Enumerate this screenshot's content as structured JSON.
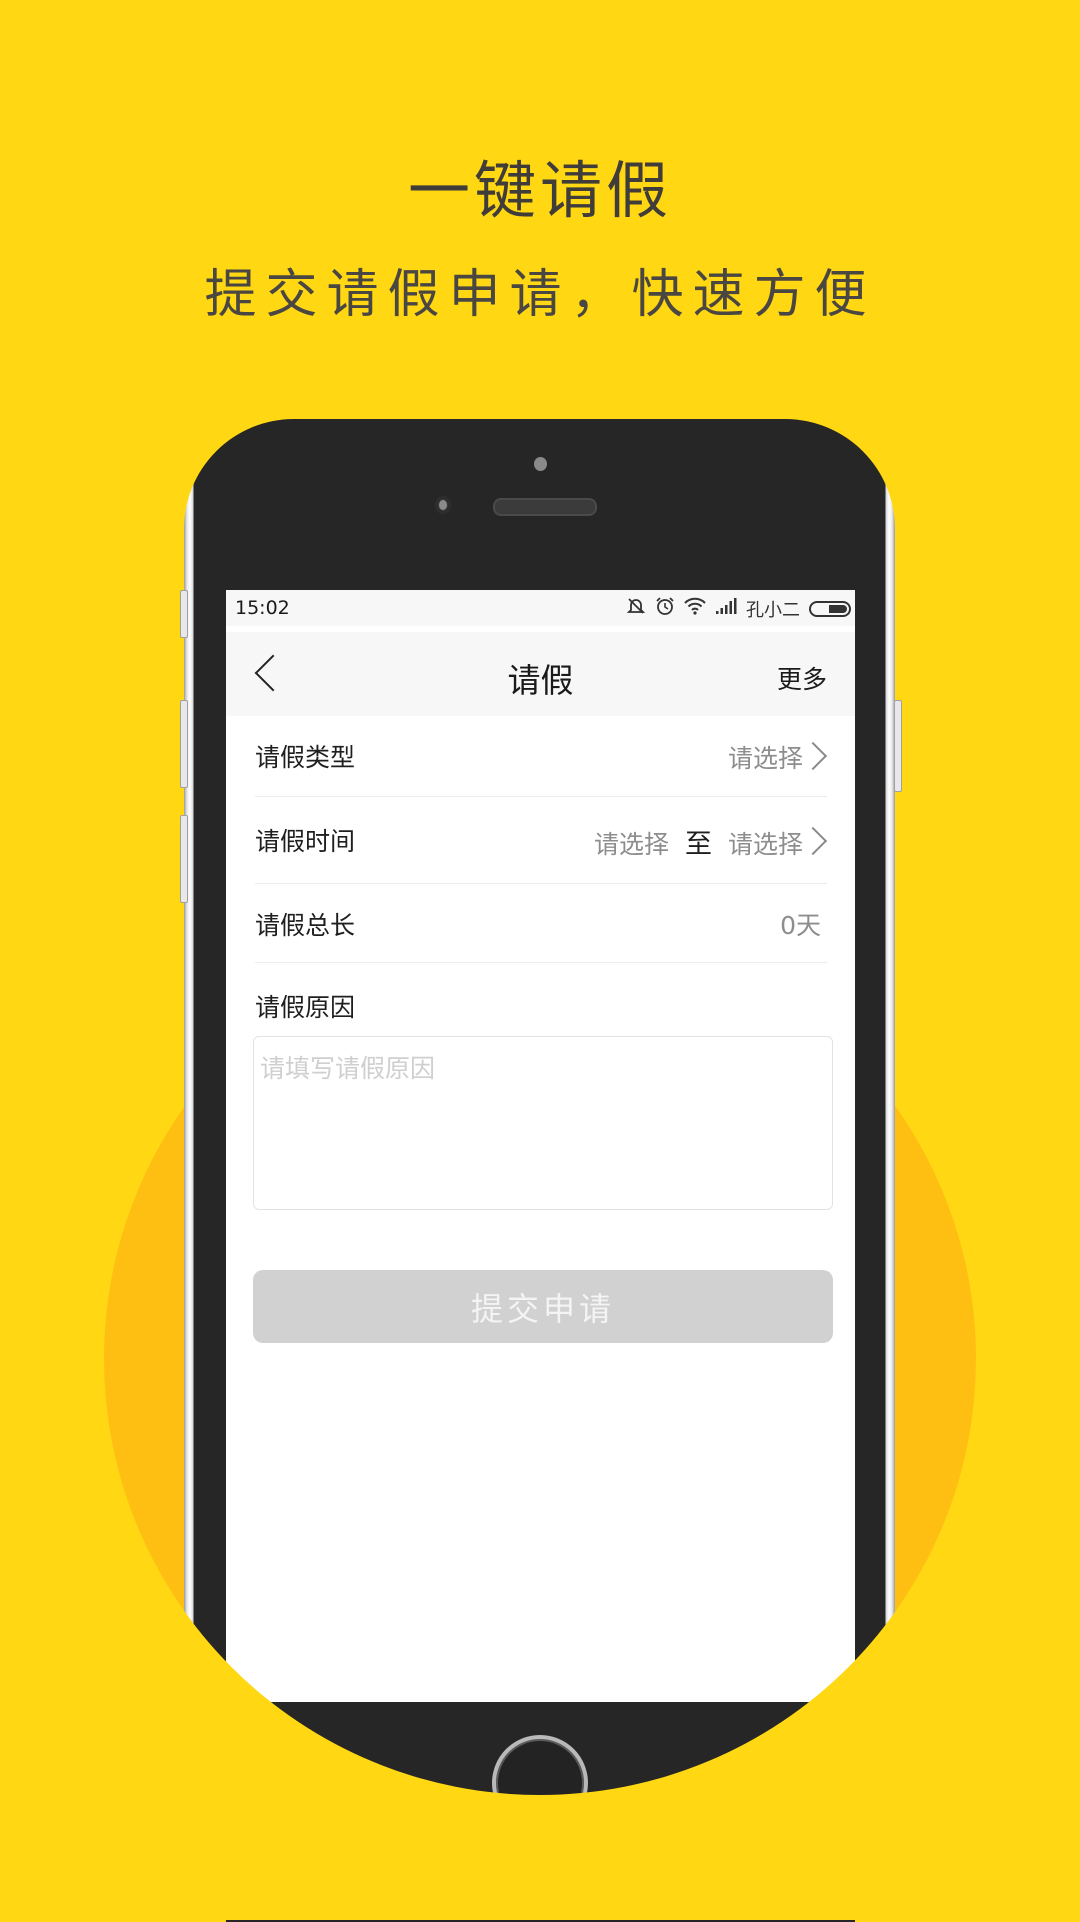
{
  "promo": {
    "headline": "一键请假",
    "subline": "提交请假申请，快速方便"
  },
  "colors": {
    "background": "#FFD712",
    "circle": "#FEBE12",
    "phone_body": "#262626",
    "submit_disabled": "#D1D1D1"
  },
  "statusbar": {
    "time": "15:02",
    "icons": [
      "mute-icon",
      "alarm-icon",
      "wifi-icon",
      "signal-icon"
    ],
    "carrier": "孔小二",
    "battery_icon": "battery-icon"
  },
  "navbar": {
    "back_icon": "chevron-left-icon",
    "title": "请假",
    "more_label": "更多"
  },
  "form": {
    "rows": [
      {
        "label": "请假类型",
        "value": "请选择"
      },
      {
        "label": "请假时间",
        "start": "请选择",
        "separator": "至",
        "end": "请选择"
      },
      {
        "label": "请假总长",
        "value": "0天"
      }
    ],
    "reason_label": "请假原因",
    "reason_placeholder": "请填写请假原因",
    "reason_value": "",
    "submit_label": "提交申请"
  }
}
